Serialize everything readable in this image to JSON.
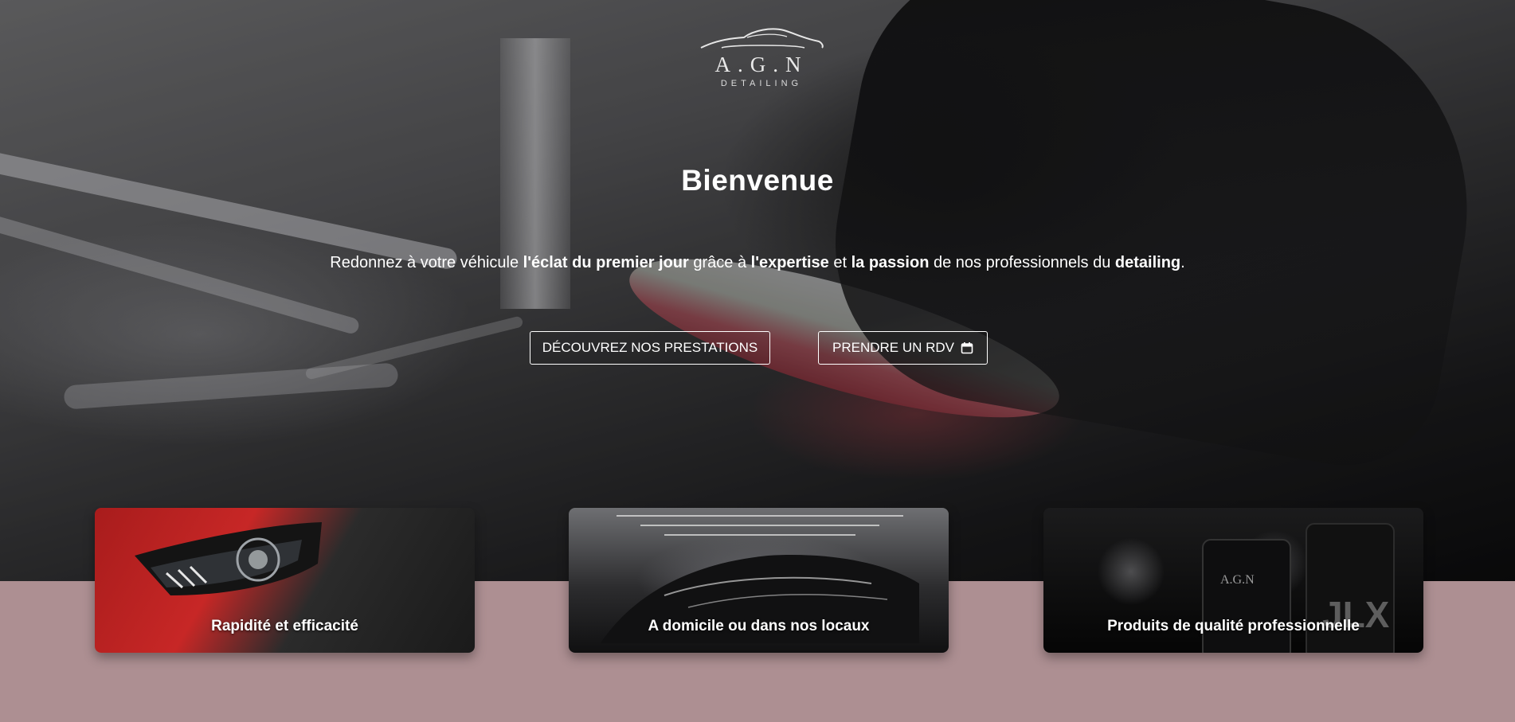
{
  "logo": {
    "brand": "A.G.N",
    "subtitle": "DETAILING",
    "icon": "car-silhouette-icon",
    "accent_color": "#d23a44"
  },
  "hero": {
    "title": "Bienvenue",
    "tagline": {
      "t1": "Redonnez à votre véhicule ",
      "b1": "l'éclat du premier jour",
      "t2": " grâce à ",
      "b2": "l'expertise",
      "t3": " et ",
      "b3": "la passion",
      "t4": " de nos professionnels du ",
      "b4": "detailing",
      "t5": "."
    }
  },
  "buttons": {
    "prestations": "DÉCOUVREZ NOS PRESTATIONS",
    "rdv": "PRENDRE UN RDV",
    "rdv_icon": "calendar-icon"
  },
  "cards": [
    {
      "label": "Rapidité et efficacité"
    },
    {
      "label": "A domicile ou dans nos locaux"
    },
    {
      "label": "Produits de qualité professionnelle"
    }
  ],
  "colors": {
    "section_background": "#ad8f92",
    "button_border": "#ffffff",
    "text": "#ffffff"
  }
}
